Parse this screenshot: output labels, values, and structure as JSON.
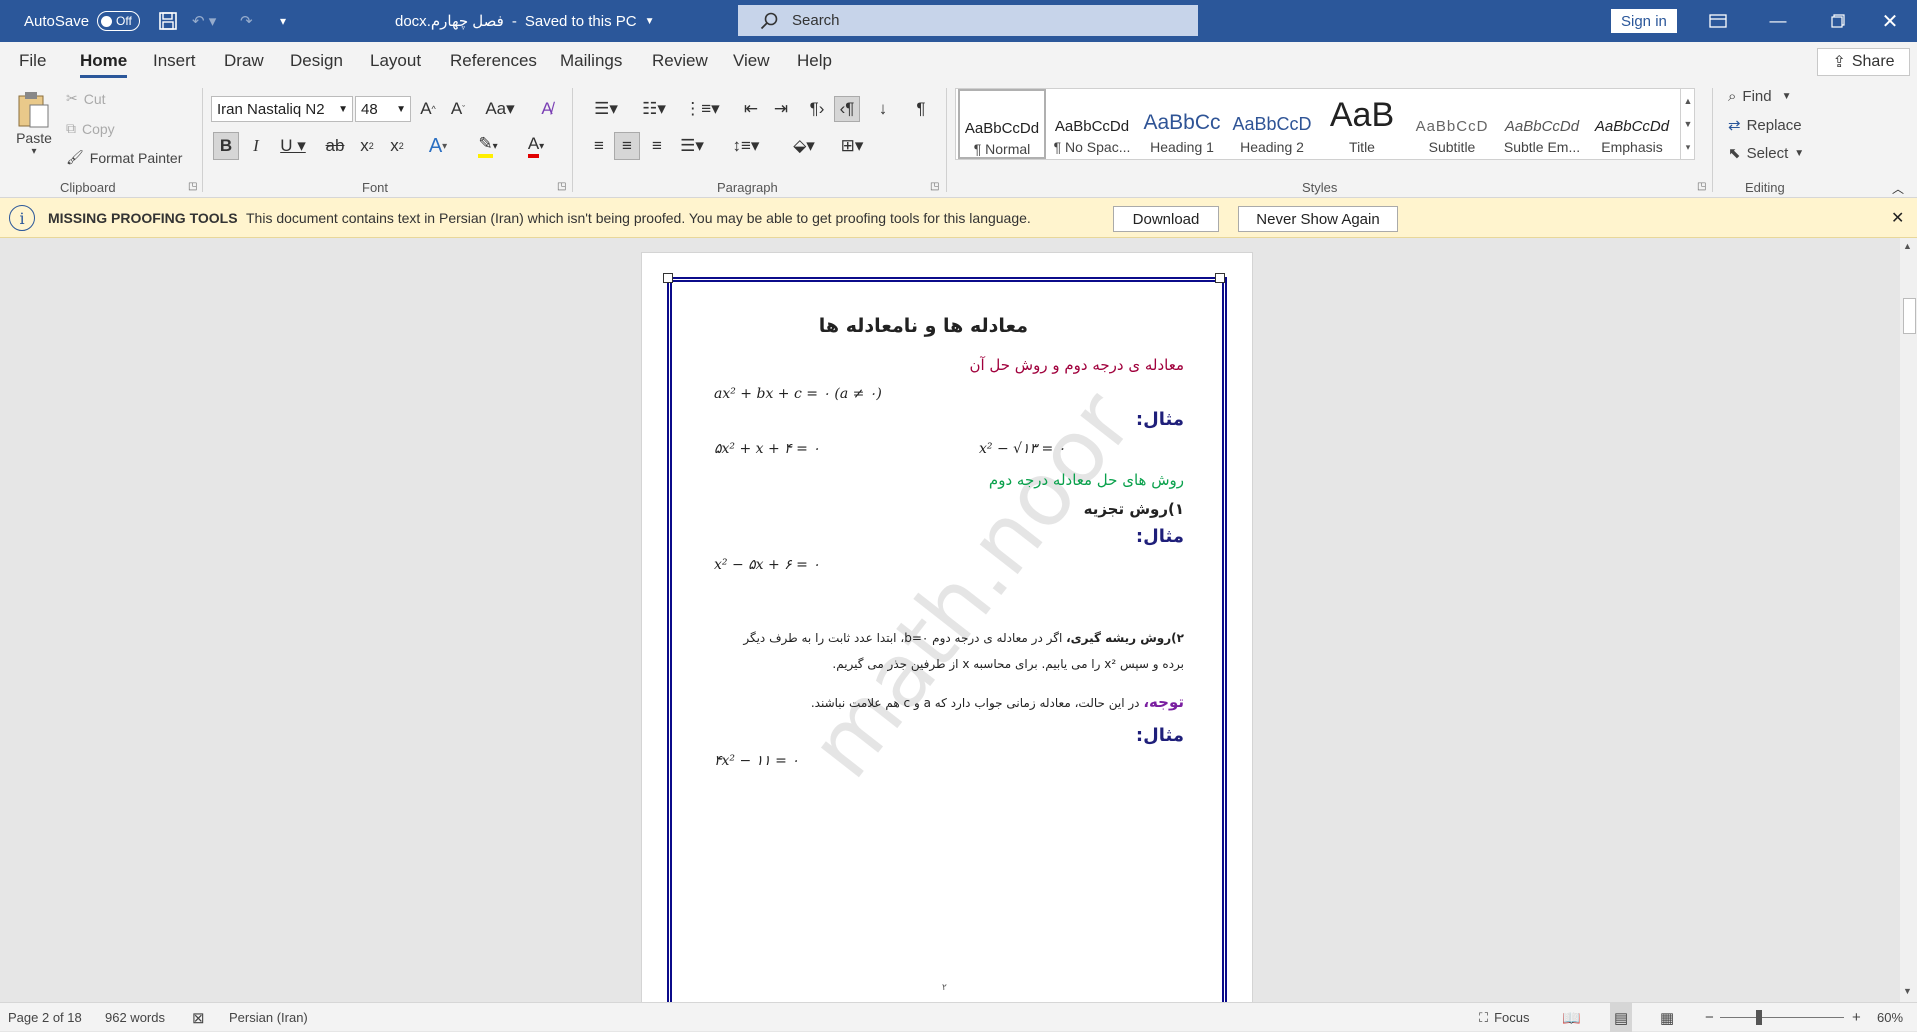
{
  "titlebar": {
    "autosave_label": "AutoSave",
    "autosave_state": "Off",
    "doc_title": "فصل چهارم.docx",
    "saved_status": "Saved to this PC",
    "search_placeholder": "Search",
    "sign_in": "Sign in"
  },
  "menu": [
    "File",
    "Home",
    "Insert",
    "Draw",
    "Design",
    "Layout",
    "References",
    "Mailings",
    "Review",
    "View",
    "Help"
  ],
  "share_label": "Share",
  "ribbon": {
    "clipboard": {
      "paste": "Paste",
      "cut": "Cut",
      "copy": "Copy",
      "format_painter": "Format Painter",
      "label": "Clipboard"
    },
    "font": {
      "name": "Iran Nastaliq N2",
      "size": "48",
      "label": "Font"
    },
    "paragraph": {
      "label": "Paragraph"
    },
    "styles": {
      "label": "Styles",
      "items": [
        {
          "preview": "AaBbCcDd",
          "name": "¶ Normal"
        },
        {
          "preview": "AaBbCcDd",
          "name": "¶ No Spac..."
        },
        {
          "preview": "AaBbCc",
          "name": "Heading 1"
        },
        {
          "preview": "AaBbCcD",
          "name": "Heading 2"
        },
        {
          "preview": "AaB",
          "name": "Title"
        },
        {
          "preview": "AaBbCcD",
          "name": "Subtitle"
        },
        {
          "preview": "AaBbCcDd",
          "name": "Subtle Em..."
        },
        {
          "preview": "AaBbCcDd",
          "name": "Emphasis"
        }
      ]
    },
    "editing": {
      "find": "Find",
      "replace": "Replace",
      "select": "Select",
      "label": "Editing"
    }
  },
  "infobar": {
    "title": "MISSING PROOFING TOOLS",
    "message": "This document contains text in Persian (Iran) which isn't being proofed. You may be able to get proofing tools for this language.",
    "download": "Download",
    "never": "Never Show Again"
  },
  "document": {
    "heading": "معادله ها و نامعادله ها",
    "subheading": "معادله ی درجه دوم و روش حل آن",
    "general_form": "ax² + bx + c = ۰    (a ≠ ۰)",
    "example_label": "مثال:",
    "eq1": "۵x² + x + ۴ = ۰",
    "eq2": "x² − √۱۳ = ۰",
    "methods_title": "روش های حل معادله درجه دوم",
    "method1": "۱)روش تجزیه",
    "eq3": "x² − ۵x + ۶ = ۰",
    "method2_title": "۲)روش ریشه گیری،",
    "method2_line1": " اگر در معادله ی درجه دوم  b=۰،  ابتدا عدد ثابت را به طرف دیگر",
    "method2_line2": "برده و سپس x² را می یابیم. برای محاسبه x از طرفین جذر می گیریم.",
    "note_label": "توجه،",
    "note_text": " در این حالت، معادله زمانی جواب دارد که a و c هم علامت نباشند.",
    "eq4": "۴x² − ۱۱ = ۰",
    "page_number": "۲",
    "watermark": "math.noor"
  },
  "status": {
    "page": "Page 2 of 18",
    "words": "962 words",
    "language": "Persian (Iran)",
    "focus": "Focus",
    "zoom": "60%"
  },
  "colors": {
    "brand": "#2b579a",
    "frame": "#0b0b8a",
    "heading_red": "#a0003c",
    "methods_green": "#0aa14c",
    "example_navy": "#1f1f7a",
    "note_purple": "#7a1fa0"
  }
}
